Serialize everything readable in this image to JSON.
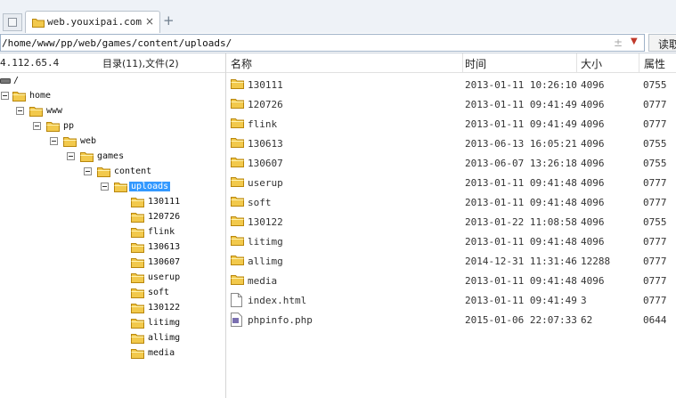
{
  "browser": {
    "tab_title": "web.youxipai.com",
    "tab_close": "×",
    "new_tab": "+",
    "address": "/home/www/pp/web/games/content/uploads/",
    "address_pm": "±",
    "address_dropdown": "▼",
    "read_button": "读取"
  },
  "left_panel": {
    "ip": "4.112.65.4",
    "dir_count": "目录(11),文件(2)"
  },
  "tree": [
    {
      "label": "/",
      "kind": "drive"
    },
    {
      "label": "home",
      "kind": "folder"
    },
    {
      "label": "www",
      "kind": "folder"
    },
    {
      "label": "pp",
      "kind": "folder"
    },
    {
      "label": "web",
      "kind": "folder"
    },
    {
      "label": "games",
      "kind": "folder"
    },
    {
      "label": "content",
      "kind": "folder"
    },
    {
      "label": "uploads",
      "kind": "folder",
      "selected": true
    },
    {
      "label": "130111",
      "kind": "folder"
    },
    {
      "label": "120726",
      "kind": "folder"
    },
    {
      "label": "flink",
      "kind": "folder"
    },
    {
      "label": "130613",
      "kind": "folder"
    },
    {
      "label": "130607",
      "kind": "folder"
    },
    {
      "label": "userup",
      "kind": "folder"
    },
    {
      "label": "soft",
      "kind": "folder"
    },
    {
      "label": "130122",
      "kind": "folder"
    },
    {
      "label": "litimg",
      "kind": "folder"
    },
    {
      "label": "allimg",
      "kind": "folder"
    },
    {
      "label": "media",
      "kind": "folder"
    }
  ],
  "file_list": {
    "headers": [
      "名称",
      "时间",
      "大小",
      "属性"
    ],
    "rows": [
      {
        "name": "130111",
        "time": "2013-01-11 10:26:10",
        "size": "4096",
        "attr": "0755",
        "type": "folder"
      },
      {
        "name": "120726",
        "time": "2013-01-11 09:41:49",
        "size": "4096",
        "attr": "0777",
        "type": "folder"
      },
      {
        "name": "flink",
        "time": "2013-01-11 09:41:49",
        "size": "4096",
        "attr": "0777",
        "type": "folder"
      },
      {
        "name": "130613",
        "time": "2013-06-13 16:05:21",
        "size": "4096",
        "attr": "0755",
        "type": "folder"
      },
      {
        "name": "130607",
        "time": "2013-06-07 13:26:18",
        "size": "4096",
        "attr": "0755",
        "type": "folder"
      },
      {
        "name": "userup",
        "time": "2013-01-11 09:41:48",
        "size": "4096",
        "attr": "0777",
        "type": "folder"
      },
      {
        "name": "soft",
        "time": "2013-01-11 09:41:48",
        "size": "4096",
        "attr": "0777",
        "type": "folder"
      },
      {
        "name": "130122",
        "time": "2013-01-22 11:08:58",
        "size": "4096",
        "attr": "0755",
        "type": "folder"
      },
      {
        "name": "litimg",
        "time": "2013-01-11 09:41:48",
        "size": "4096",
        "attr": "0777",
        "type": "folder"
      },
      {
        "name": "allimg",
        "time": "2014-12-31 11:31:46",
        "size": "12288",
        "attr": "0777",
        "type": "folder"
      },
      {
        "name": "media",
        "time": "2013-01-11 09:41:48",
        "size": "4096",
        "attr": "0777",
        "type": "folder"
      },
      {
        "name": "index.html",
        "time": "2013-01-11 09:41:49",
        "size": "3",
        "attr": "0777",
        "type": "file"
      },
      {
        "name": "phpinfo.php",
        "time": "2015-01-06 22:07:33",
        "size": "62",
        "attr": "0644",
        "type": "php"
      }
    ]
  },
  "colors": {
    "selection": "#3399ff",
    "folder": "#f2c94c",
    "folder_border": "#b8860b"
  }
}
